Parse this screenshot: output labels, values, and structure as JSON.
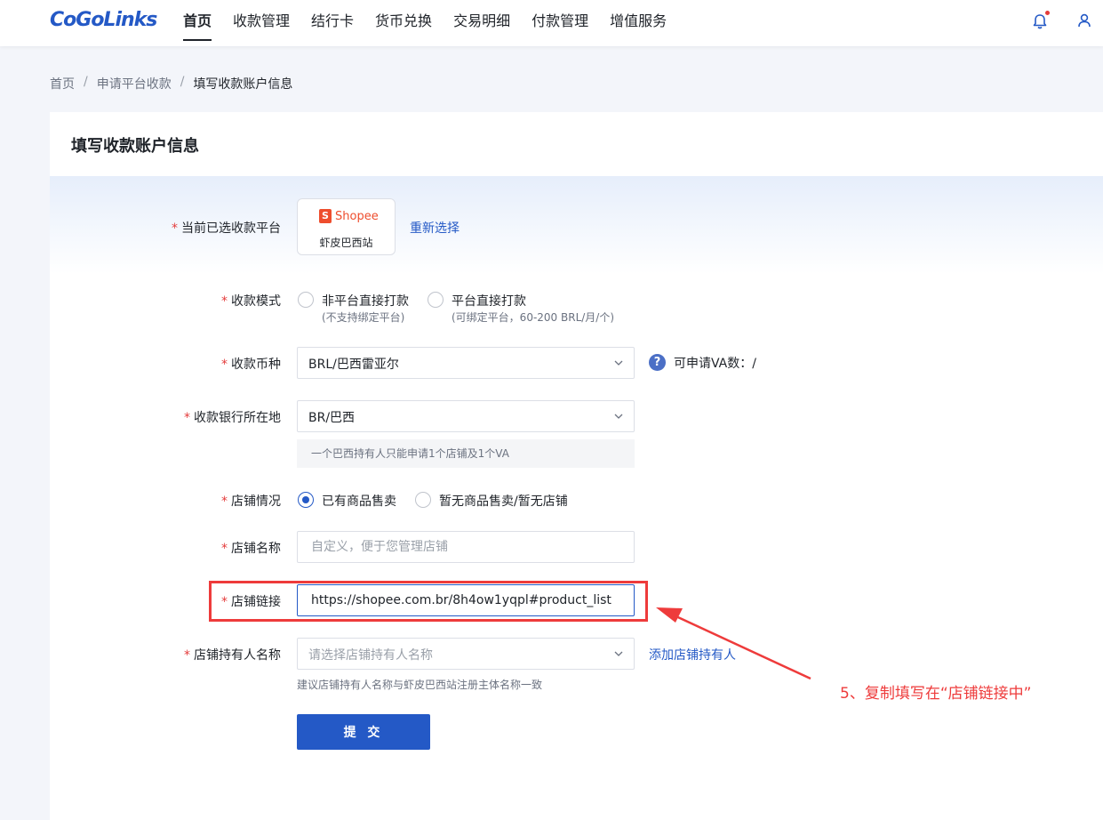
{
  "brand": {
    "logo_text": "CoGoLinks",
    "accent": "#2459c6",
    "annotation_color": "#ee3b3b"
  },
  "nav": {
    "items": [
      {
        "label": "首页",
        "active": true
      },
      {
        "label": "收款管理"
      },
      {
        "label": "结行卡"
      },
      {
        "label": "货币兑换"
      },
      {
        "label": "交易明细"
      },
      {
        "label": "付款管理"
      },
      {
        "label": "增值服务"
      }
    ],
    "icons": [
      "bell-icon",
      "user-icon"
    ]
  },
  "breadcrumb": {
    "items": [
      "首页",
      "申请平台收款",
      "填写收款账户信息"
    ],
    "separator": "/"
  },
  "form": {
    "title": "填写收款账户信息",
    "required_mark": "*",
    "platform": {
      "label": "当前已选收款平台",
      "logo_text": "Shopee",
      "logo_badge": "S",
      "name": "虾皮巴西站",
      "reselect": "重新选择"
    },
    "mode": {
      "label": "收款模式",
      "options": [
        {
          "text": "非平台直接打款",
          "sub": "(不支持绑定平台)",
          "checked": false
        },
        {
          "text": "平台直接打款",
          "sub": "(可绑定平台，60-200 BRL/月/个)",
          "checked": false
        }
      ]
    },
    "currency": {
      "label": "收款币种",
      "value": "BRL/巴西雷亚尔",
      "help_icon": "?",
      "va_text": "可申请VA数：/"
    },
    "bank_location": {
      "label": "收款银行所在地",
      "value": "BR/巴西",
      "hint": "一个巴西持有人只能申请1个店铺及1个VA"
    },
    "store_status": {
      "label": "店铺情况",
      "options": [
        {
          "text": "已有商品售卖",
          "checked": true
        },
        {
          "text": "暂无商品售卖/暂无店铺",
          "checked": false
        }
      ]
    },
    "store_name": {
      "label": "店铺名称",
      "placeholder": "自定义，便于您管理店铺",
      "value": ""
    },
    "store_link": {
      "label": "店铺链接",
      "value": "https://shopee.com.br/8h4ow1yqpl#product_list"
    },
    "store_owner": {
      "label": "店铺持有人名称",
      "placeholder": "请选择店铺持有人名称",
      "add_link": "添加店铺持有人",
      "hint": "建议店铺持有人名称与虾皮巴西站注册主体名称一致"
    },
    "submit_label": "提 交"
  },
  "annotation": {
    "text": "5、复制填写在“店铺链接中”"
  }
}
